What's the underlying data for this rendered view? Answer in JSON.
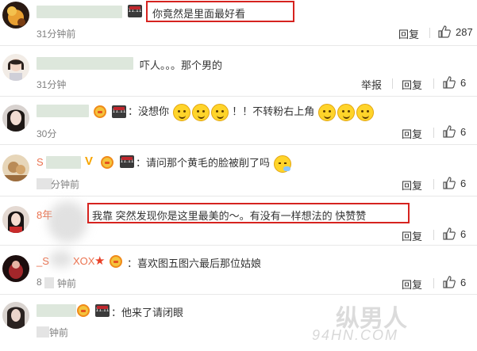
{
  "comments": [
    {
      "name": "",
      "text": "你竟然是里面最好看",
      "time": "31分钟前",
      "reply": "回复",
      "like": "287"
    },
    {
      "name": "",
      "text": "吓人。。。那个男的",
      "time": "31分钟",
      "report": "举报",
      "reply": "回复",
      "like": "6"
    },
    {
      "name": "",
      "text_before": "：没想你",
      "text_mid": "！！不转粉右上角",
      "time": "30分",
      "reply": "回复",
      "like": "6"
    },
    {
      "name": "S",
      "vtag": "V",
      "text": "：请问那个黄毛的脸被削了吗",
      "time": "分钟前",
      "reply": "回复",
      "like": "6"
    },
    {
      "name": "8年",
      "text": "我靠 突然发现你是这里最美的～。有没有一样想法的 快赞赞",
      "reply": "回复",
      "like": "6"
    },
    {
      "name": "_S",
      "name_tail": "XOX",
      "text": "：喜欢图五图六最后那位姑娘",
      "time": "8",
      "time_tail": "钟前",
      "reply": "回复",
      "like": "6"
    },
    {
      "name": "",
      "text": "：他来了请闭眼",
      "time": "钟前",
      "reply": "回复",
      "like": "6"
    }
  ],
  "badge_text": "11.11",
  "watermark": {
    "line1": "纵男人",
    "line2": "94HN.COM"
  },
  "colors": {
    "name": "#eb7350",
    "highlight_box": "#d6231f",
    "text": "#333333",
    "time": "#808080"
  },
  "icons": [
    "thumbs-up-icon",
    "smile-emoji-icon",
    "scratch-head-emoji-icon",
    "vip-crown-icon",
    "double-eleven-badge-icon",
    "star-icon"
  ]
}
